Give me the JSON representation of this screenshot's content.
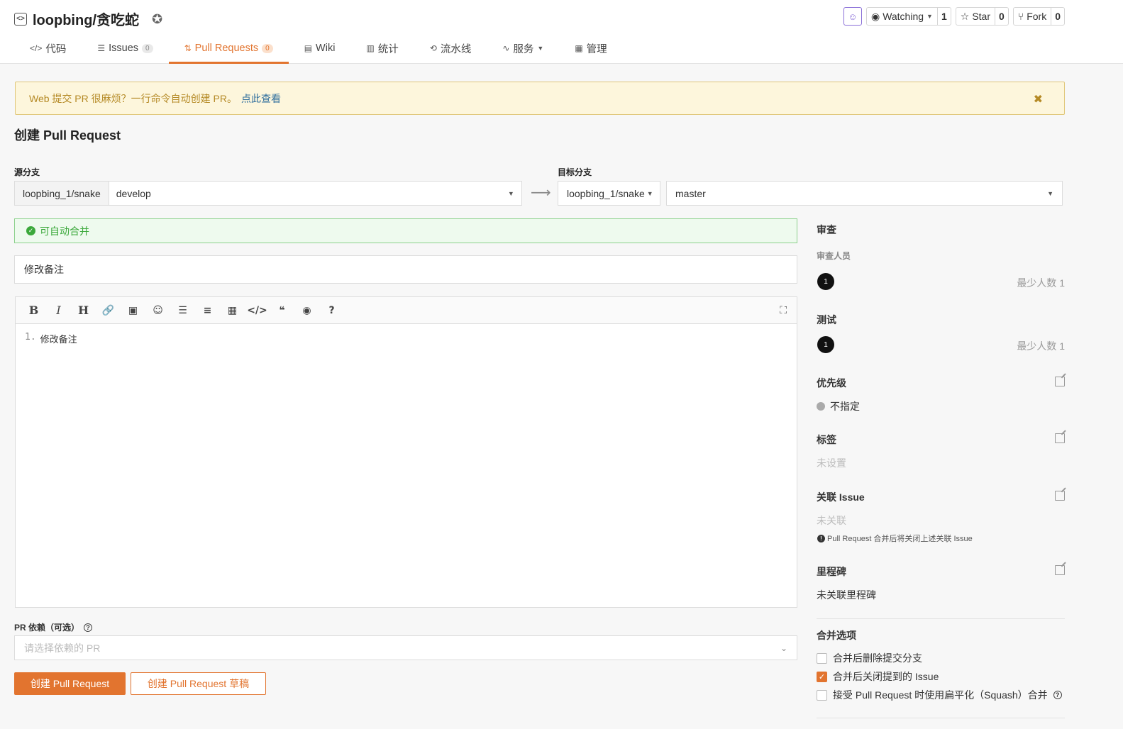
{
  "repo": {
    "name": "loopbing/贪吃蛇"
  },
  "actions": {
    "watch_label": "Watching",
    "watch_count": "1",
    "star_label": "Star",
    "star_count": "0",
    "fork_label": "Fork",
    "fork_count": "0"
  },
  "tabs": [
    {
      "label": "代码"
    },
    {
      "label": "Issues",
      "count": "0"
    },
    {
      "label": "Pull Requests",
      "count": "0"
    },
    {
      "label": "Wiki"
    },
    {
      "label": "统计"
    },
    {
      "label": "流水线"
    },
    {
      "label": "服务"
    },
    {
      "label": "管理"
    }
  ],
  "notice": {
    "text": "Web 提交 PR 很麻烦？一行命令自动创建 PR。",
    "link": "点此查看",
    "close": "✖"
  },
  "page_title": "创建 Pull Request",
  "source": {
    "label": "源分支",
    "repo": "loopbing_1/snake",
    "branch": "develop"
  },
  "target": {
    "label": "目标分支",
    "repo": "loopbing_1/snake",
    "branch": "master"
  },
  "merge_status": "可自动合并",
  "form": {
    "title_value": "修改备注",
    "editor_line_number": "1.",
    "editor_content": "修改备注",
    "dependency_label": "PR 依赖（可选）",
    "dependency_placeholder": "请选择依赖的 PR",
    "create_button": "创建 Pull Request",
    "draft_button": "创建 Pull Request 草稿"
  },
  "sidebar": {
    "review_title": "审查",
    "reviewers_label": "审查人员",
    "reviewer_count": "1",
    "review_min": "最少人数 1",
    "test_title": "测试",
    "tester_count": "1",
    "test_min": "最少人数 1",
    "priority_title": "优先级",
    "priority_value": "不指定",
    "labels_title": "标签",
    "labels_value": "未设置",
    "issue_title": "关联 Issue",
    "issue_value": "未关联",
    "issue_note": "Pull Request 合并后将关闭上述关联 Issue",
    "milestone_title": "里程碑",
    "milestone_value": "未关联里程碑",
    "merge_options_title": "合并选项",
    "option_delete_branch": "合并后删除提交分支",
    "option_delete_branch_checked": false,
    "option_close_issue": "合并后关闭提到的 Issue",
    "option_close_issue_checked": true,
    "option_squash": "接受 Pull Request 时使用扁平化（Squash）合并",
    "option_squash_checked": false
  },
  "colors": {
    "accent": "#e2742f",
    "success": "#3aa83a",
    "notice_bg": "#fdf6dc"
  }
}
